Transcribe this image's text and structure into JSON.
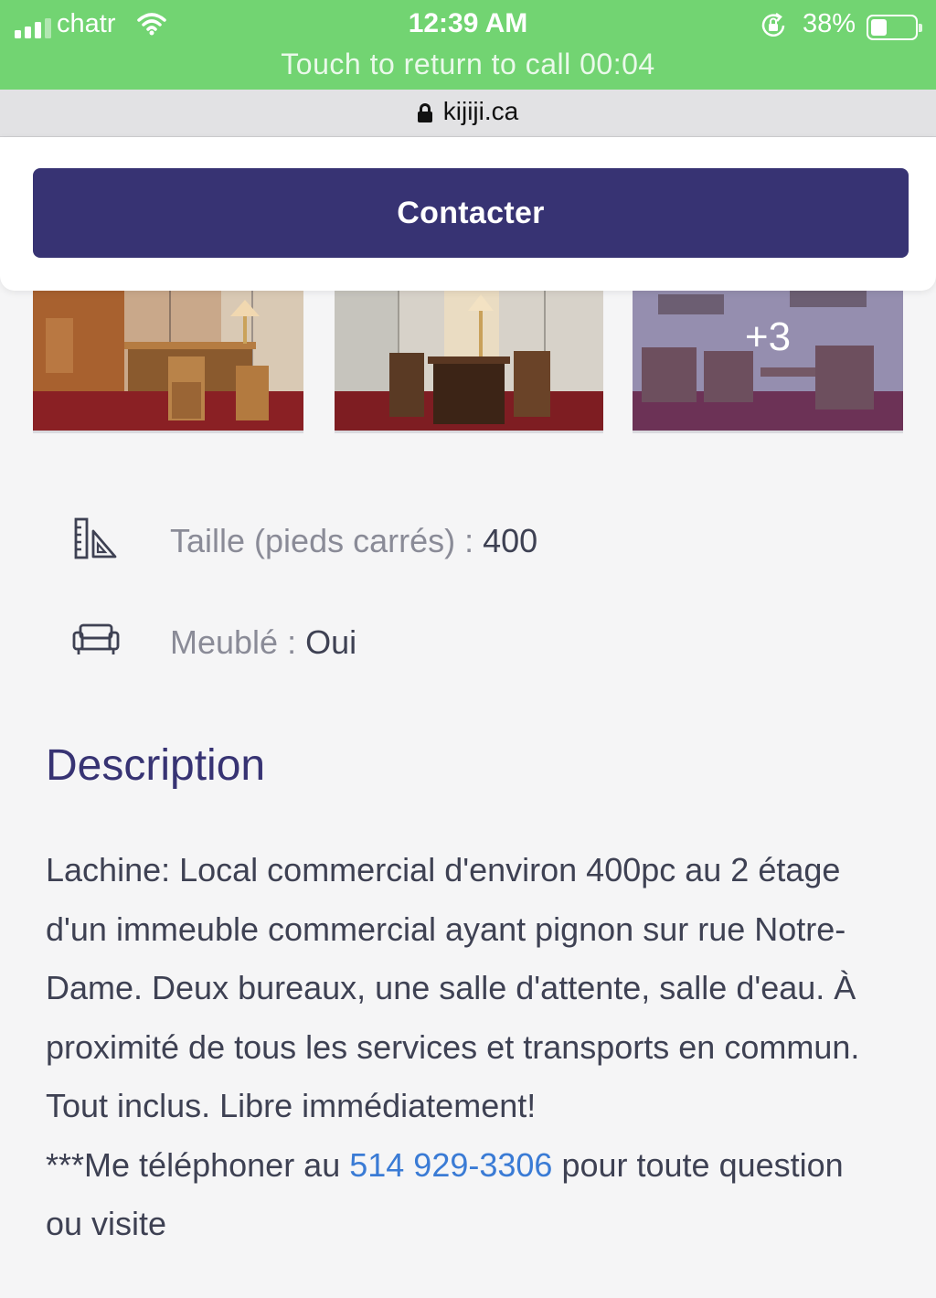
{
  "status": {
    "carrier": "chatr",
    "time": "12:39 AM",
    "battery_pct": "38%",
    "battery_level": 0.38,
    "call_banner": "Touch to return to call 00:04"
  },
  "browser": {
    "url": "kijiji.ca"
  },
  "contact": {
    "button_label": "Contacter"
  },
  "gallery": {
    "more_count": "+3"
  },
  "attributes": [
    {
      "icon": "ruler-triangle-icon",
      "label": "Taille (pieds carrés) : ",
      "value": "400"
    },
    {
      "icon": "sofa-icon",
      "label": "Meublé : ",
      "value": "Oui"
    }
  ],
  "description": {
    "title": "Description",
    "body": "Lachine: Local commercial d'environ 400pc au 2 étage d'un immeuble commercial ayant pignon sur rue Notre-Dame. Deux bureaux, une salle d'attente, salle d'eau. À proximité de tous les services et transports en commun. Tout inclus. Libre immédiatement!",
    "phone_prefix": "***Me téléphoner au ",
    "phone": "514 929-3306",
    "phone_suffix": " pour toute question ou visite"
  },
  "colors": {
    "status_green": "#72d472",
    "brand_purple": "#373373",
    "link_blue": "#3a7bd5"
  }
}
